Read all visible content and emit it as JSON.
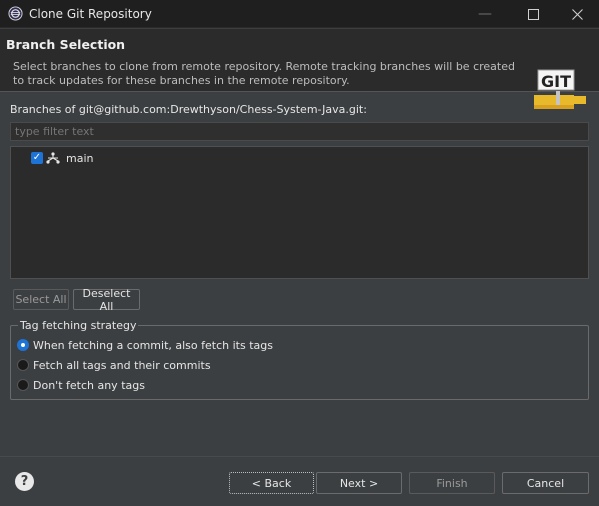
{
  "window": {
    "title": "Clone Git Repository",
    "minimize_icon": "minimize-icon",
    "maximize_icon": "maximize-icon",
    "close_icon": "close-icon"
  },
  "header": {
    "title": "Branch Selection",
    "description": "Select branches to clone from remote repository. Remote tracking branches will be created to track updates for these branches in the remote repository.",
    "logo_text": "GIT"
  },
  "branches": {
    "label": "Branches of git@github.com:Drewthyson/Chess-System-Java.git:",
    "filter_placeholder": "type filter text",
    "items": [
      {
        "name": "main",
        "checked": true
      }
    ]
  },
  "buttons": {
    "select_all": "Select All",
    "deselect_all": "Deselect All",
    "back": "< Back",
    "next": "Next >",
    "finish": "Finish",
    "cancel": "Cancel"
  },
  "tag_strategy": {
    "legend": "Tag fetching strategy",
    "options": [
      {
        "label": "When fetching a commit, also fetch its tags",
        "selected": true
      },
      {
        "label": "Fetch all tags and their commits",
        "selected": false
      },
      {
        "label": "Don't fetch any tags",
        "selected": false
      }
    ]
  },
  "colors": {
    "accent": "#1e73d6",
    "background": "#3c3f41",
    "titlebar": "#1f1f1f"
  }
}
